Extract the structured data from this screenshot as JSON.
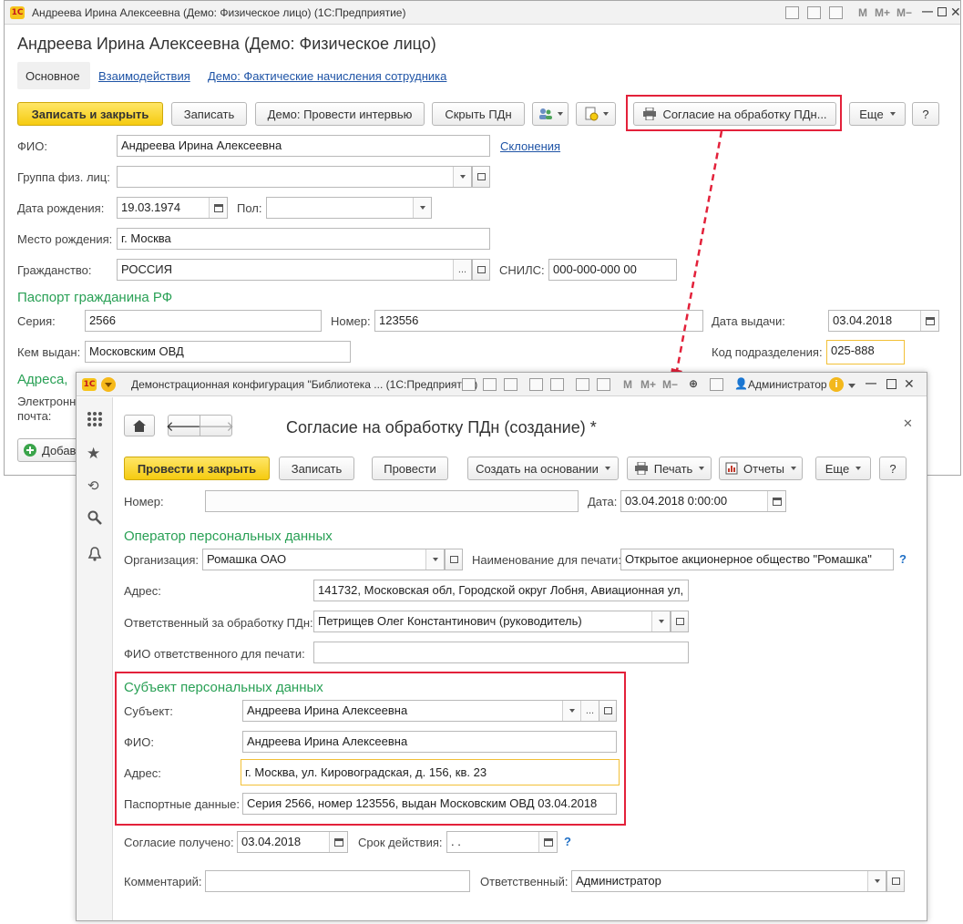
{
  "main_window": {
    "title": "Андреева Ирина Алексеевна (Демо: Физическое лицо)  (1С:Предприятие)",
    "form_title": "Андреева Ирина Алексеевна (Демо: Физическое лицо)",
    "tabs": [
      "Основное",
      "Взаимодействия",
      "Демо: Фактические начисления сотрудника"
    ],
    "toolbar": {
      "save_close": "Записать и закрыть",
      "save": "Записать",
      "interview": "Демо: Провести интервью",
      "hide_pd": "Скрыть ПДн",
      "consent": "Согласие на обработку ПДн...",
      "more": "Еще",
      "help": "?"
    },
    "fields": {
      "fio_label": "ФИО:",
      "fio_value": "Андреева Ирина Алексеевна",
      "declensions_link": "Склонения",
      "group_label": "Группа физ. лиц:",
      "group_value": "",
      "birth_date_label": "Дата рождения:",
      "birth_date_value": "19.03.1974",
      "gender_label": "Пол:",
      "gender_value": "",
      "birth_place_label": "Место рождения:",
      "birth_place_value": "г. Москва",
      "citizenship_label": "Гражданство:",
      "citizenship_value": "РОССИЯ",
      "snils_label": "СНИЛС:",
      "snils_value": "000-000-000 00"
    },
    "passport": {
      "section_title": "Паспорт гражданина РФ",
      "series_label": "Серия:",
      "series_value": "2566",
      "number_label": "Номер:",
      "number_value": "123556",
      "issue_date_label": "Дата выдачи:",
      "issue_date_value": "03.04.2018",
      "issued_by_label": "Кем выдан:",
      "issued_by_value": "Московским ОВД",
      "dept_code_label": "Код подразделения:",
      "dept_code_value": "025-888"
    },
    "addresses": {
      "section_title": "Адреса,",
      "email_label_1": "Электронн",
      "email_label_2": "почта:",
      "add_button": "Добав"
    }
  },
  "dialog": {
    "title": "Демонстрационная конфигурация \"Библиотека ...  (1С:Предприятие)",
    "user": "Администратор",
    "form_title": "Согласие на обработку ПДн (создание) *",
    "toolbar": {
      "post_close": "Провести и закрыть",
      "save": "Записать",
      "post": "Провести",
      "create_based": "Создать на основании",
      "print": "Печать",
      "reports": "Отчеты",
      "more": "Еще",
      "help": "?"
    },
    "header": {
      "number_label": "Номер:",
      "number_value": "",
      "date_label": "Дата:",
      "date_value": "03.04.2018  0:00:00"
    },
    "operator": {
      "section_title": "Оператор персональных данных",
      "org_label": "Организация:",
      "org_value": "Ромашка ОАО",
      "print_name_label": "Наименование для печати:",
      "print_name_value": "Открытое акционерное общество \"Ромашка\"",
      "address_label": "Адрес:",
      "address_value": "141732, Московская обл, Городской округ Лобня, Авиационная ул,",
      "responsible_label": "Ответственный за обработку ПДн:",
      "responsible_value": "Петрищев Олег Константинович (руководитель)",
      "responsible_print_label": "ФИО ответственного для печати:",
      "responsible_print_value": ""
    },
    "subject": {
      "section_title": "Субъект персональных данных",
      "subject_label": "Субъект:",
      "subject_value": "Андреева Ирина Алексеевна",
      "fio_label": "ФИО:",
      "fio_value": "Андреева Ирина Алексеевна",
      "address_label": "Адрес:",
      "address_value": "г. Москва, ул. Кировоградская, д. 156, кв. 23",
      "passport_label": "Паспортные данные:",
      "passport_value": "Серия 2566, номер 123556, выдан Московским ОВД 03.04.2018"
    },
    "footer": {
      "consent_date_label": "Согласие получено:",
      "consent_date_value": "03.04.2018",
      "validity_label": "Срок действия:",
      "validity_value": " .  .",
      "comment_label": "Комментарий:",
      "comment_value": "",
      "responsible_label": "Ответственный:",
      "responsible_value": "Администратор"
    }
  },
  "colors": {
    "accent_yellow": "#f5cb10",
    "section_green": "#29a055",
    "highlight_red": "#e3213a",
    "link_blue": "#1f54a6"
  }
}
